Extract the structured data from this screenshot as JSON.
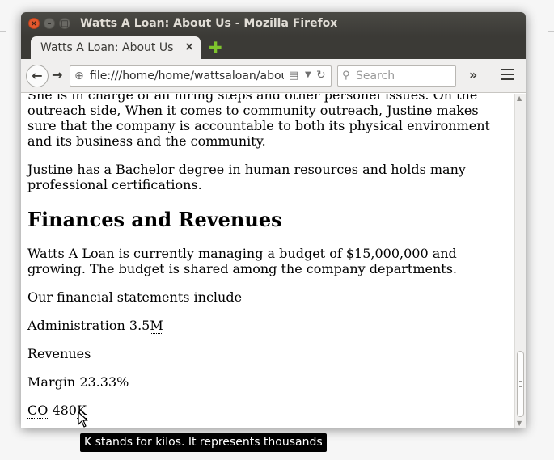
{
  "window": {
    "title": "Watts A Loan: About Us - Mozilla Firefox",
    "controls": {
      "close": "×",
      "minimize": "–",
      "maximize": "□"
    }
  },
  "tabs": [
    {
      "label": "Watts A Loan: About Us",
      "close": "×",
      "active": true
    }
  ],
  "new_tab_glyph": "✚",
  "navbar": {
    "back_glyph": "←",
    "forward_glyph": "→",
    "url": "file:///home/home/wattsaloan/about.htm",
    "search_placeholder": "Search",
    "overflow_glyph": "»"
  },
  "page": {
    "para1": "She is in charge of all hiring steps and other personel issues. On the outreach side, When it comes to community outreach, Justine makes sure that the company is accountable to both its physical environment and its business and the community.",
    "para2": "Justine has a Bachelor degree in human resources and holds many professional certifications.",
    "heading": "Finances and Revenues",
    "para3": "Watts A Loan is currently managing a budget of $15,000,000 and growing. The budget is shared among the company departments.",
    "para4": "Our financial statements include",
    "admin": {
      "label": "Administration 3.5",
      "abbr": "M"
    },
    "revenues": "Revenues",
    "margin": "Margin 23.33%",
    "co": {
      "abbr": "CO",
      "value_prefix": " 480",
      "abbr2": "K"
    }
  },
  "tooltip": "K stands for kilos. It represents thousands",
  "colors": {
    "titlebar": "#3b3a36",
    "close_button": "#e3582d",
    "new_tab": "#7ec32d"
  }
}
